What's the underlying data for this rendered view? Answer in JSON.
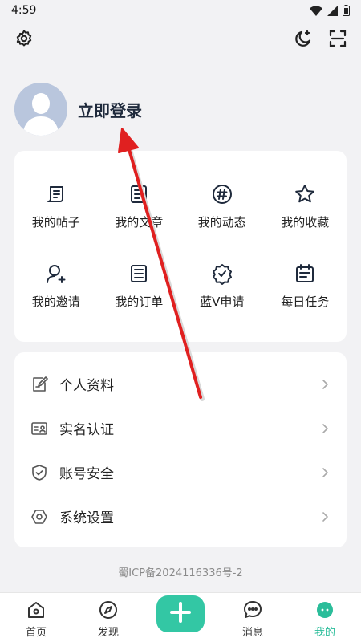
{
  "status_bar": {
    "time": "4:59"
  },
  "top_bar": {
    "settings_icon": "gear-icon",
    "theme_icon": "moon-icon",
    "scan_icon": "scan-icon"
  },
  "profile": {
    "login_text": "立即登录"
  },
  "grid": {
    "items": [
      {
        "label": "我的帖子",
        "icon": "post-icon"
      },
      {
        "label": "我的文章",
        "icon": "article-icon"
      },
      {
        "label": "我的动态",
        "icon": "hashtag-icon"
      },
      {
        "label": "我的收藏",
        "icon": "star-icon"
      },
      {
        "label": "我的邀请",
        "icon": "invite-icon"
      },
      {
        "label": "我的订单",
        "icon": "order-icon"
      },
      {
        "label": "蓝V申请",
        "icon": "verified-badge-icon"
      },
      {
        "label": "每日任务",
        "icon": "calendar-icon"
      }
    ]
  },
  "menu": {
    "items": [
      {
        "label": "个人资料",
        "icon": "edit-profile-icon"
      },
      {
        "label": "实名认证",
        "icon": "id-card-icon"
      },
      {
        "label": "账号安全",
        "icon": "shield-icon"
      },
      {
        "label": "系统设置",
        "icon": "hexagon-settings-icon"
      }
    ]
  },
  "icp": "蜀ICP备2024116336号-2",
  "tabbar": {
    "items": [
      {
        "label": "首页",
        "icon": "home-icon"
      },
      {
        "label": "发现",
        "icon": "compass-icon"
      },
      {
        "label": "",
        "icon": "plus-icon"
      },
      {
        "label": "消息",
        "icon": "message-icon"
      },
      {
        "label": "我的",
        "icon": "profile-face-icon"
      }
    ],
    "active_index": 4
  },
  "colors": {
    "accent": "#33c7a4",
    "active_tab": "#2bbd9a",
    "annotation_arrow": "#e02020"
  }
}
